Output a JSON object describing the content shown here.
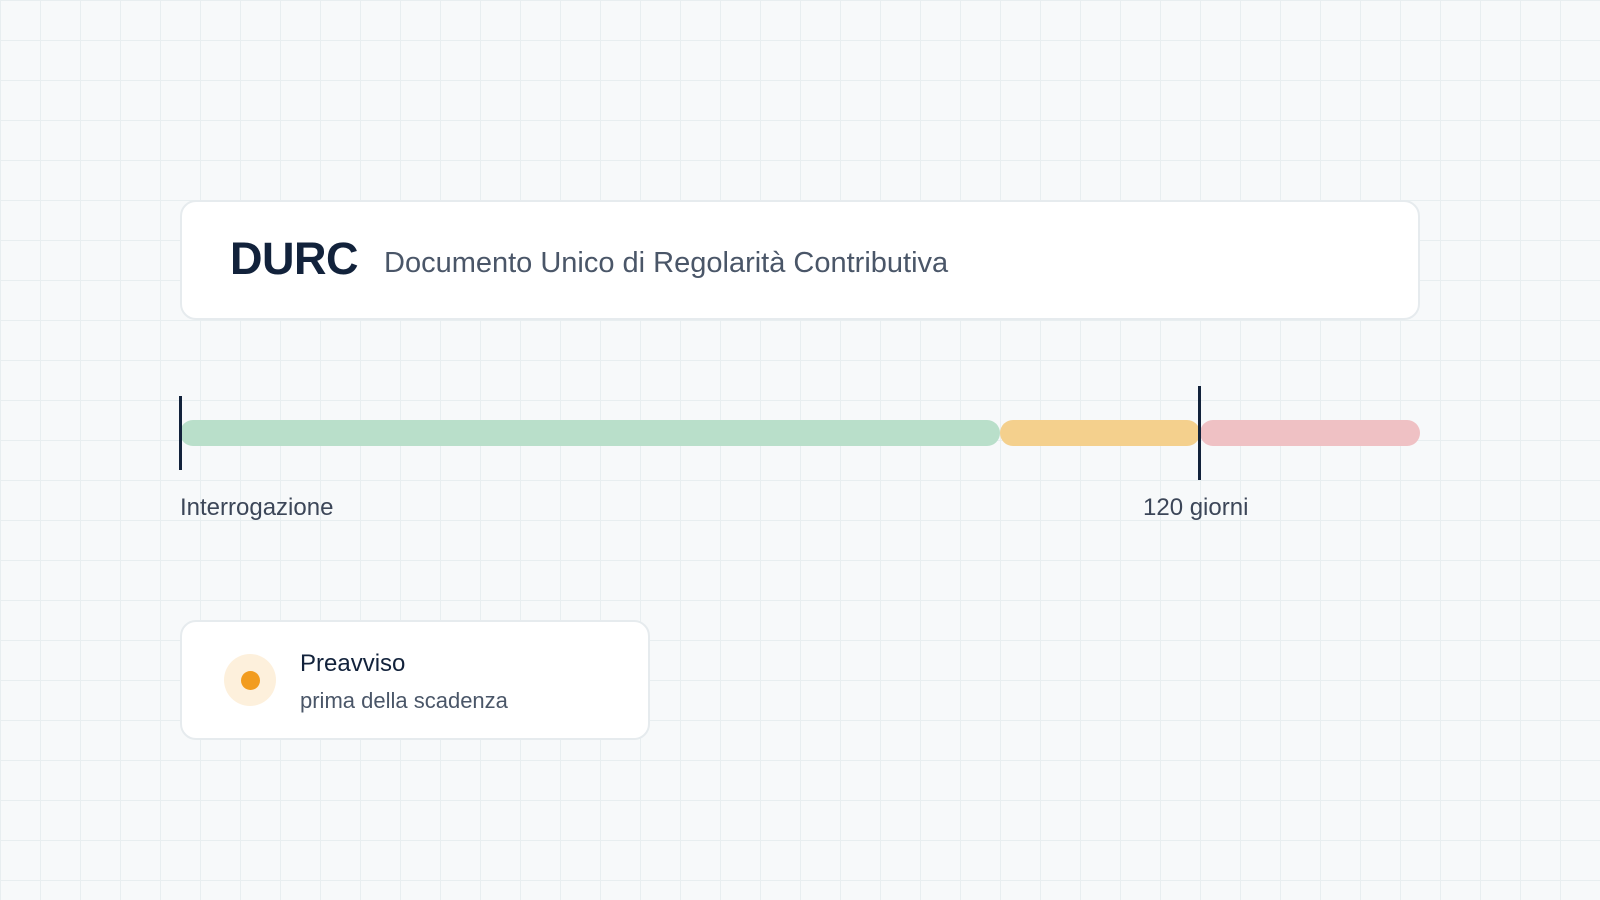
{
  "header": {
    "title": "DURC",
    "subtitle": "Documento Unico di Regolarità Contributiva"
  },
  "timeline": {
    "segments": [
      {
        "name": "valid",
        "color": "#b9dfca"
      },
      {
        "name": "warning",
        "color": "#f4d08d"
      },
      {
        "name": "expired",
        "color": "#efc1c4"
      }
    ],
    "markers": [
      {
        "label": "Interrogazione"
      },
      {
        "label": "120 giorni"
      }
    ]
  },
  "legend": {
    "title": "Preavviso",
    "description": "prima della scadenza",
    "dot_color": "#f29c1f",
    "dot_halo_color": "#fdf0dc"
  }
}
